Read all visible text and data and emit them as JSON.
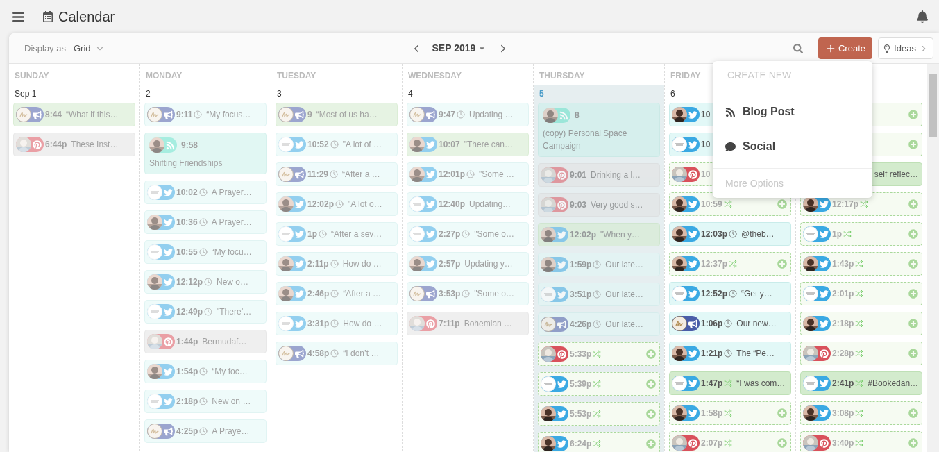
{
  "app_title": "Calendar",
  "toolbar": {
    "display_label": "Display as",
    "display_value": "Grid",
    "month": "SEP 2019",
    "create_label": "Create",
    "ideas_label": "Ideas"
  },
  "days": [
    {
      "name": "SUNDAY",
      "date": "Sep 1",
      "today": false,
      "past": true,
      "items": [
        {
          "kind": "published",
          "network": {
            "kind": "campaign"
          },
          "avatar": {
            "kind": "script"
          },
          "time": "8:44",
          "text": "“What if this…"
        },
        {
          "kind": "draft",
          "network": {
            "kind": "pinterest"
          },
          "time": "6:44p",
          "text": "These Inst…"
        }
      ]
    },
    {
      "name": "MONDAY",
      "date": "2",
      "today": false,
      "past": true,
      "items": [
        {
          "kind": "scheduled",
          "network": {
            "kind": "campaign"
          },
          "avatar": {
            "kind": "script"
          },
          "time": "9:11",
          "status": {
            "kind": "clock"
          },
          "text": "“My focus…"
        },
        {
          "kind": "blog",
          "network": {
            "kind": "rss"
          },
          "avatar": {
            "kind": "person"
          },
          "time": "9:58",
          "text": "Shifting Friendships"
        },
        {
          "kind": "scheduled",
          "network": {
            "kind": "twitter"
          },
          "avatar": {
            "kind": "logo"
          },
          "time": "10:02",
          "status": {
            "kind": "clock"
          },
          "text": "A Prayer…"
        },
        {
          "kind": "scheduled",
          "network": {
            "kind": "twitter"
          },
          "avatar": {
            "kind": "person"
          },
          "time": "10:36",
          "status": {
            "kind": "clock"
          },
          "text": "A Prayer…"
        },
        {
          "kind": "scheduled",
          "network": {
            "kind": "twitter"
          },
          "avatar": {
            "kind": "logo"
          },
          "time": "10:55",
          "status": {
            "kind": "clock"
          },
          "text": "“My focu…"
        },
        {
          "kind": "scheduled",
          "network": {
            "kind": "twitter"
          },
          "avatar": {
            "kind": "person"
          },
          "time": "12:12p",
          "status": {
            "kind": "clock"
          },
          "text": "New o…"
        },
        {
          "kind": "scheduled",
          "network": {
            "kind": "twitter"
          },
          "avatar": {
            "kind": "logo"
          },
          "time": "12:49p",
          "status": {
            "kind": "clock"
          },
          "text": "\"There’…"
        },
        {
          "kind": "draft",
          "network": {
            "kind": "pinterest"
          },
          "time": "1:44p",
          "text": "Bermudaf…"
        },
        {
          "kind": "scheduled",
          "network": {
            "kind": "twitter"
          },
          "avatar": {
            "kind": "person"
          },
          "time": "1:54p",
          "status": {
            "kind": "clock"
          },
          "text": "“My foc…"
        },
        {
          "kind": "scheduled",
          "network": {
            "kind": "twitter"
          },
          "avatar": {
            "kind": "logo"
          },
          "time": "2:18p",
          "status": {
            "kind": "clock"
          },
          "text": "New on …"
        },
        {
          "kind": "scheduled",
          "network": {
            "kind": "campaign"
          },
          "avatar": {
            "kind": "script"
          },
          "time": "4:25p",
          "status": {
            "kind": "clock"
          },
          "text": "A Praye…"
        }
      ]
    },
    {
      "name": "TUESDAY",
      "date": "3",
      "today": false,
      "past": true,
      "items": [
        {
          "kind": "published",
          "network": {
            "kind": "campaign"
          },
          "avatar": {
            "kind": "script"
          },
          "time": "9",
          "text": "“Most of us ha…"
        },
        {
          "kind": "scheduled",
          "network": {
            "kind": "twitter"
          },
          "avatar": {
            "kind": "logo"
          },
          "time": "10:52",
          "status": {
            "kind": "clock"
          },
          "text": "\"A lot of …"
        },
        {
          "kind": "scheduled",
          "network": {
            "kind": "campaign"
          },
          "avatar": {
            "kind": "script"
          },
          "time": "11:29",
          "status": {
            "kind": "clock"
          },
          "text": "“After a …"
        },
        {
          "kind": "scheduled",
          "network": {
            "kind": "twitter"
          },
          "avatar": {
            "kind": "person"
          },
          "time": "12:02p",
          "status": {
            "kind": "clock"
          },
          "text": "\"A lot o…"
        },
        {
          "kind": "scheduled",
          "network": {
            "kind": "twitter"
          },
          "avatar": {
            "kind": "logo"
          },
          "time": "1p",
          "status": {
            "kind": "clock"
          },
          "text": "“After a sev…"
        },
        {
          "kind": "scheduled",
          "network": {
            "kind": "twitter"
          },
          "avatar": {
            "kind": "person"
          },
          "time": "2:11p",
          "status": {
            "kind": "clock"
          },
          "text": "How do …"
        },
        {
          "kind": "scheduled",
          "network": {
            "kind": "twitter"
          },
          "avatar": {
            "kind": "person"
          },
          "time": "2:46p",
          "status": {
            "kind": "clock"
          },
          "text": "“After a …"
        },
        {
          "kind": "scheduled",
          "network": {
            "kind": "twitter"
          },
          "avatar": {
            "kind": "logo"
          },
          "time": "3:31p",
          "status": {
            "kind": "clock"
          },
          "text": "How do …"
        },
        {
          "kind": "scheduled",
          "network": {
            "kind": "campaign"
          },
          "avatar": {
            "kind": "script"
          },
          "time": "4:58p",
          "status": {
            "kind": "clock"
          },
          "text": "“I don’t …"
        }
      ]
    },
    {
      "name": "WEDNESDAY",
      "date": "4",
      "today": false,
      "past": true,
      "items": [
        {
          "kind": "scheduled",
          "network": {
            "kind": "campaign"
          },
          "avatar": {
            "kind": "script"
          },
          "time": "9:47",
          "status": {
            "kind": "clock"
          },
          "text": "Updating …"
        },
        {
          "kind": "published",
          "network": {
            "kind": "twitter"
          },
          "avatar": {
            "kind": "person"
          },
          "time": "10:07",
          "text": "\"There can…"
        },
        {
          "kind": "scheduled",
          "network": {
            "kind": "twitter"
          },
          "avatar": {
            "kind": "person"
          },
          "time": "12:01p",
          "status": {
            "kind": "clock"
          },
          "text": "\"Some …"
        },
        {
          "kind": "scheduled",
          "network": {
            "kind": "twitter"
          },
          "avatar": {
            "kind": "logo"
          },
          "time": "12:40p",
          "text": "Updating…"
        },
        {
          "kind": "scheduled",
          "network": {
            "kind": "twitter"
          },
          "avatar": {
            "kind": "logo"
          },
          "time": "2:27p",
          "status": {
            "kind": "clock"
          },
          "text": "\"Some o…"
        },
        {
          "kind": "scheduled",
          "network": {
            "kind": "twitter"
          },
          "avatar": {
            "kind": "person"
          },
          "time": "2:57p",
          "text": "Updating y…"
        },
        {
          "kind": "scheduled",
          "network": {
            "kind": "campaign"
          },
          "avatar": {
            "kind": "script"
          },
          "time": "3:53p",
          "status": {
            "kind": "clock"
          },
          "text": "\"Some o…"
        },
        {
          "kind": "draft",
          "network": {
            "kind": "pinterest"
          },
          "time": "7:11p",
          "text": "Bohemian …"
        }
      ]
    },
    {
      "name": "THURSDAY",
      "date": "5",
      "today": true,
      "past": true,
      "items": [
        {
          "kind": "blog",
          "network": {
            "kind": "rss"
          },
          "avatar": {
            "kind": "person"
          },
          "time": "8",
          "text": "(copy) Personal Space Campaign"
        },
        {
          "kind": "draft",
          "network": {
            "kind": "pinterest"
          },
          "time": "9:01",
          "text": "Drinking a l…"
        },
        {
          "kind": "draft",
          "network": {
            "kind": "pinterest"
          },
          "time": "9:03",
          "text": "Very good s…"
        },
        {
          "kind": "published",
          "network": {
            "kind": "twitter"
          },
          "avatar": {
            "kind": "person"
          },
          "time": "12:02p",
          "text": "\"When y…"
        },
        {
          "kind": "scheduled",
          "network": {
            "kind": "twitter"
          },
          "avatar": {
            "kind": "person"
          },
          "time": "1:59p",
          "status": {
            "kind": "clock"
          },
          "text": "Our late…"
        },
        {
          "kind": "scheduled",
          "network": {
            "kind": "twitter"
          },
          "avatar": {
            "kind": "logo"
          },
          "time": "3:51p",
          "status": {
            "kind": "clock"
          },
          "text": "Our late…"
        },
        {
          "kind": "scheduled",
          "network": {
            "kind": "campaign"
          },
          "avatar": {
            "kind": "script"
          },
          "time": "4:26p",
          "status": {
            "kind": "clock"
          },
          "text": "Our late…"
        },
        {
          "kind": "slot",
          "network": {
            "kind": "pinterest"
          },
          "time": "5:33p",
          "status": {
            "kind": "shuffle"
          }
        },
        {
          "kind": "slot",
          "network": {
            "kind": "twitter"
          },
          "avatar": {
            "kind": "logo"
          },
          "time": "5:39p",
          "status": {
            "kind": "shuffle"
          }
        },
        {
          "kind": "slot",
          "network": {
            "kind": "twitter"
          },
          "avatar": {
            "kind": "person"
          },
          "time": "5:53p",
          "status": {
            "kind": "shuffle"
          }
        },
        {
          "kind": "slot",
          "network": {
            "kind": "twitter"
          },
          "avatar": {
            "kind": "person"
          },
          "time": "6:24p",
          "status": {
            "kind": "shuffle"
          }
        }
      ]
    },
    {
      "name": "FRIDAY",
      "date": "6",
      "today": false,
      "past": false,
      "items": [
        {
          "kind": "scheduled",
          "network": {
            "kind": "twitter"
          },
          "avatar": {
            "kind": "person"
          },
          "time": "10"
        },
        {
          "kind": "scheduled",
          "network": {
            "kind": "twitter"
          },
          "avatar": {
            "kind": "logo"
          },
          "time": "10"
        },
        {
          "kind": "slot",
          "network": {
            "kind": "pinterest"
          },
          "time": "10"
        },
        {
          "kind": "slot",
          "network": {
            "kind": "twitter"
          },
          "avatar": {
            "kind": "person"
          },
          "time": "10:59",
          "status": {
            "kind": "shuffle"
          }
        },
        {
          "kind": "scheduled",
          "network": {
            "kind": "twitter"
          },
          "avatar": {
            "kind": "person"
          },
          "time": "12:03p",
          "status": {
            "kind": "clock"
          },
          "text": "@theb…"
        },
        {
          "kind": "slot",
          "network": {
            "kind": "twitter"
          },
          "avatar": {
            "kind": "person"
          },
          "time": "12:37p",
          "status": {
            "kind": "shuffle"
          }
        },
        {
          "kind": "scheduled",
          "network": {
            "kind": "twitter"
          },
          "avatar": {
            "kind": "logo"
          },
          "time": "12:52p",
          "status": {
            "kind": "clock"
          },
          "text": "“Get y…"
        },
        {
          "kind": "scheduled",
          "network": {
            "kind": "campaign"
          },
          "avatar": {
            "kind": "script"
          },
          "time": "1:06p",
          "status": {
            "kind": "clock"
          },
          "text": "Our new…"
        },
        {
          "kind": "scheduled",
          "network": {
            "kind": "twitter"
          },
          "avatar": {
            "kind": "person"
          },
          "time": "1:21p",
          "status": {
            "kind": "clock"
          },
          "text": "The “Pe…"
        },
        {
          "kind": "published",
          "network": {
            "kind": "twitter"
          },
          "avatar": {
            "kind": "logo"
          },
          "time": "1:47p",
          "status": {
            "kind": "shuffle"
          },
          "text": "“I was com…"
        },
        {
          "kind": "slot",
          "network": {
            "kind": "twitter"
          },
          "avatar": {
            "kind": "person"
          },
          "time": "1:58p",
          "status": {
            "kind": "shuffle"
          }
        },
        {
          "kind": "slot",
          "network": {
            "kind": "pinterest"
          },
          "time": "2:07p",
          "status": {
            "kind": "shuffle"
          }
        }
      ]
    },
    {
      "today": false,
      "past": false,
      "items": [
        {
          "kind": "slot"
        },
        {
          "kind": "slot"
        },
        {
          "kind": "published",
          "text": "self reflec…"
        },
        {
          "kind": "slot",
          "network": {
            "kind": "twitter"
          },
          "avatar": {
            "kind": "person"
          },
          "time": "12:17p",
          "status": {
            "kind": "shuffle"
          }
        },
        {
          "kind": "slot",
          "network": {
            "kind": "twitter"
          },
          "avatar": {
            "kind": "logo"
          },
          "time": "1p",
          "status": {
            "kind": "shuffle"
          }
        },
        {
          "kind": "slot",
          "network": {
            "kind": "twitter"
          },
          "avatar": {
            "kind": "person"
          },
          "time": "1:43p",
          "status": {
            "kind": "shuffle"
          }
        },
        {
          "kind": "slot",
          "network": {
            "kind": "twitter"
          },
          "avatar": {
            "kind": "logo"
          },
          "time": "2:01p",
          "status": {
            "kind": "shuffle"
          }
        },
        {
          "kind": "slot",
          "network": {
            "kind": "twitter"
          },
          "avatar": {
            "kind": "person"
          },
          "time": "2:18p",
          "status": {
            "kind": "shuffle"
          }
        },
        {
          "kind": "slot",
          "network": {
            "kind": "pinterest"
          },
          "time": "2:28p",
          "status": {
            "kind": "shuffle"
          }
        },
        {
          "kind": "published",
          "network": {
            "kind": "twitter"
          },
          "avatar": {
            "kind": "logo"
          },
          "time": "2:41p",
          "status": {
            "kind": "shuffle"
          },
          "text": "#Bookedan…"
        },
        {
          "kind": "slot",
          "network": {
            "kind": "twitter"
          },
          "avatar": {
            "kind": "person"
          },
          "time": "3:08p",
          "status": {
            "kind": "shuffle"
          }
        },
        {
          "kind": "slot",
          "network": {
            "kind": "pinterest"
          },
          "time": "3:40p",
          "status": {
            "kind": "shuffle"
          }
        }
      ]
    }
  ],
  "create_menu": {
    "heading": "CREATE NEW",
    "items": [
      {
        "kind": "blog",
        "label": "Blog Post"
      },
      {
        "kind": "social",
        "label": "Social"
      }
    ],
    "footer": "More Options"
  }
}
